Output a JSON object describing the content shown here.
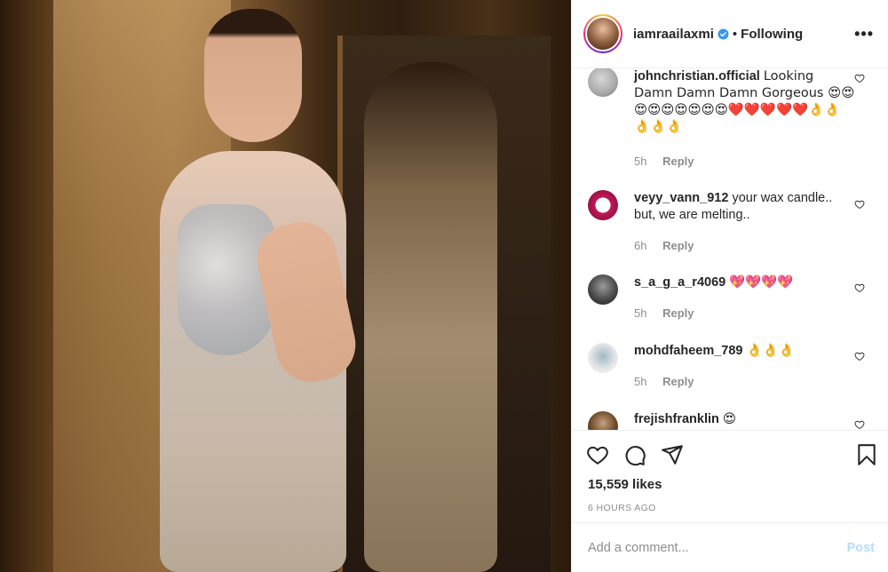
{
  "post": {
    "username": "iamraailaxmi",
    "following_label": "Following",
    "separator": "•",
    "more_label": "•••"
  },
  "comments": [
    {
      "user": "johnchristian.official",
      "text": "Looking Damn Damn Damn Gorgeous 😍😍😍😍😍😍😍😍😍❤️❤️❤️❤️❤️👌👌👌👌👌",
      "age": "5h",
      "reply": "Reply"
    },
    {
      "user": "veyy_vann_912",
      "text": "your wax candle.. but, we are melting..",
      "age": "6h",
      "reply": "Reply"
    },
    {
      "user": "s_a_g_a_r4069",
      "text": "💖💖💖💖",
      "age": "5h",
      "reply": "Reply"
    },
    {
      "user": "mohdfaheem_789",
      "text": "👌👌👌",
      "age": "5h",
      "reply": "Reply"
    },
    {
      "user": "frejishfranklin",
      "text": "😍",
      "age": "",
      "reply": ""
    }
  ],
  "stats": {
    "likes": "15,559 likes",
    "time": "6 HOURS AGO"
  },
  "composer": {
    "placeholder": "Add a comment...",
    "post_label": "Post"
  },
  "icons": [
    "heart-icon",
    "comment-icon",
    "share-icon",
    "bookmark-icon",
    "verified-icon",
    "more-icon"
  ],
  "colors": {
    "accent": "#0095f6",
    "post_disabled": "#b2dffc",
    "muted": "#8e8e8e"
  }
}
